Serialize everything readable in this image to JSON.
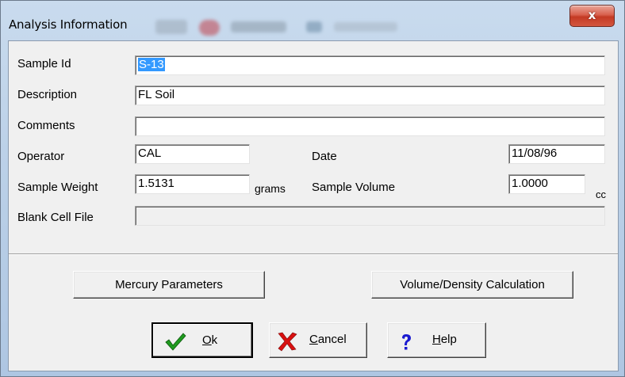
{
  "window": {
    "title": "Analysis Information",
    "close_glyph": "x"
  },
  "form": {
    "sample_id_label": "Sample Id",
    "sample_id_value": "S-13",
    "description_label": "Description",
    "description_value": "FL Soil",
    "comments_label": "Comments",
    "comments_value": "",
    "operator_label": "Operator",
    "operator_value": "CAL",
    "date_label": "Date",
    "date_value": "11/08/96",
    "sample_weight_label": "Sample Weight",
    "sample_weight_value": "1.5131",
    "sample_weight_unit": "grams",
    "sample_volume_label": "Sample Volume",
    "sample_volume_value": "1.0000",
    "sample_volume_unit": "cc",
    "blank_cell_label": "Blank Cell File",
    "blank_cell_value": ""
  },
  "buttons": {
    "mercury_parameters": "Mercury Parameters",
    "volume_density": "Volume/Density Calculation",
    "ok_mnemonic": "O",
    "ok_rest": "k",
    "cancel_mnemonic": "C",
    "cancel_rest": "ancel",
    "help_mnemonic": "H",
    "help_rest": "elp"
  },
  "icons": {
    "ok": "checkmark-icon",
    "cancel": "cross-icon",
    "help": "question-mark-icon",
    "ok_color": "#1f9a1f",
    "cancel_color": "#d81010",
    "help_color": "#1a1ad0"
  }
}
